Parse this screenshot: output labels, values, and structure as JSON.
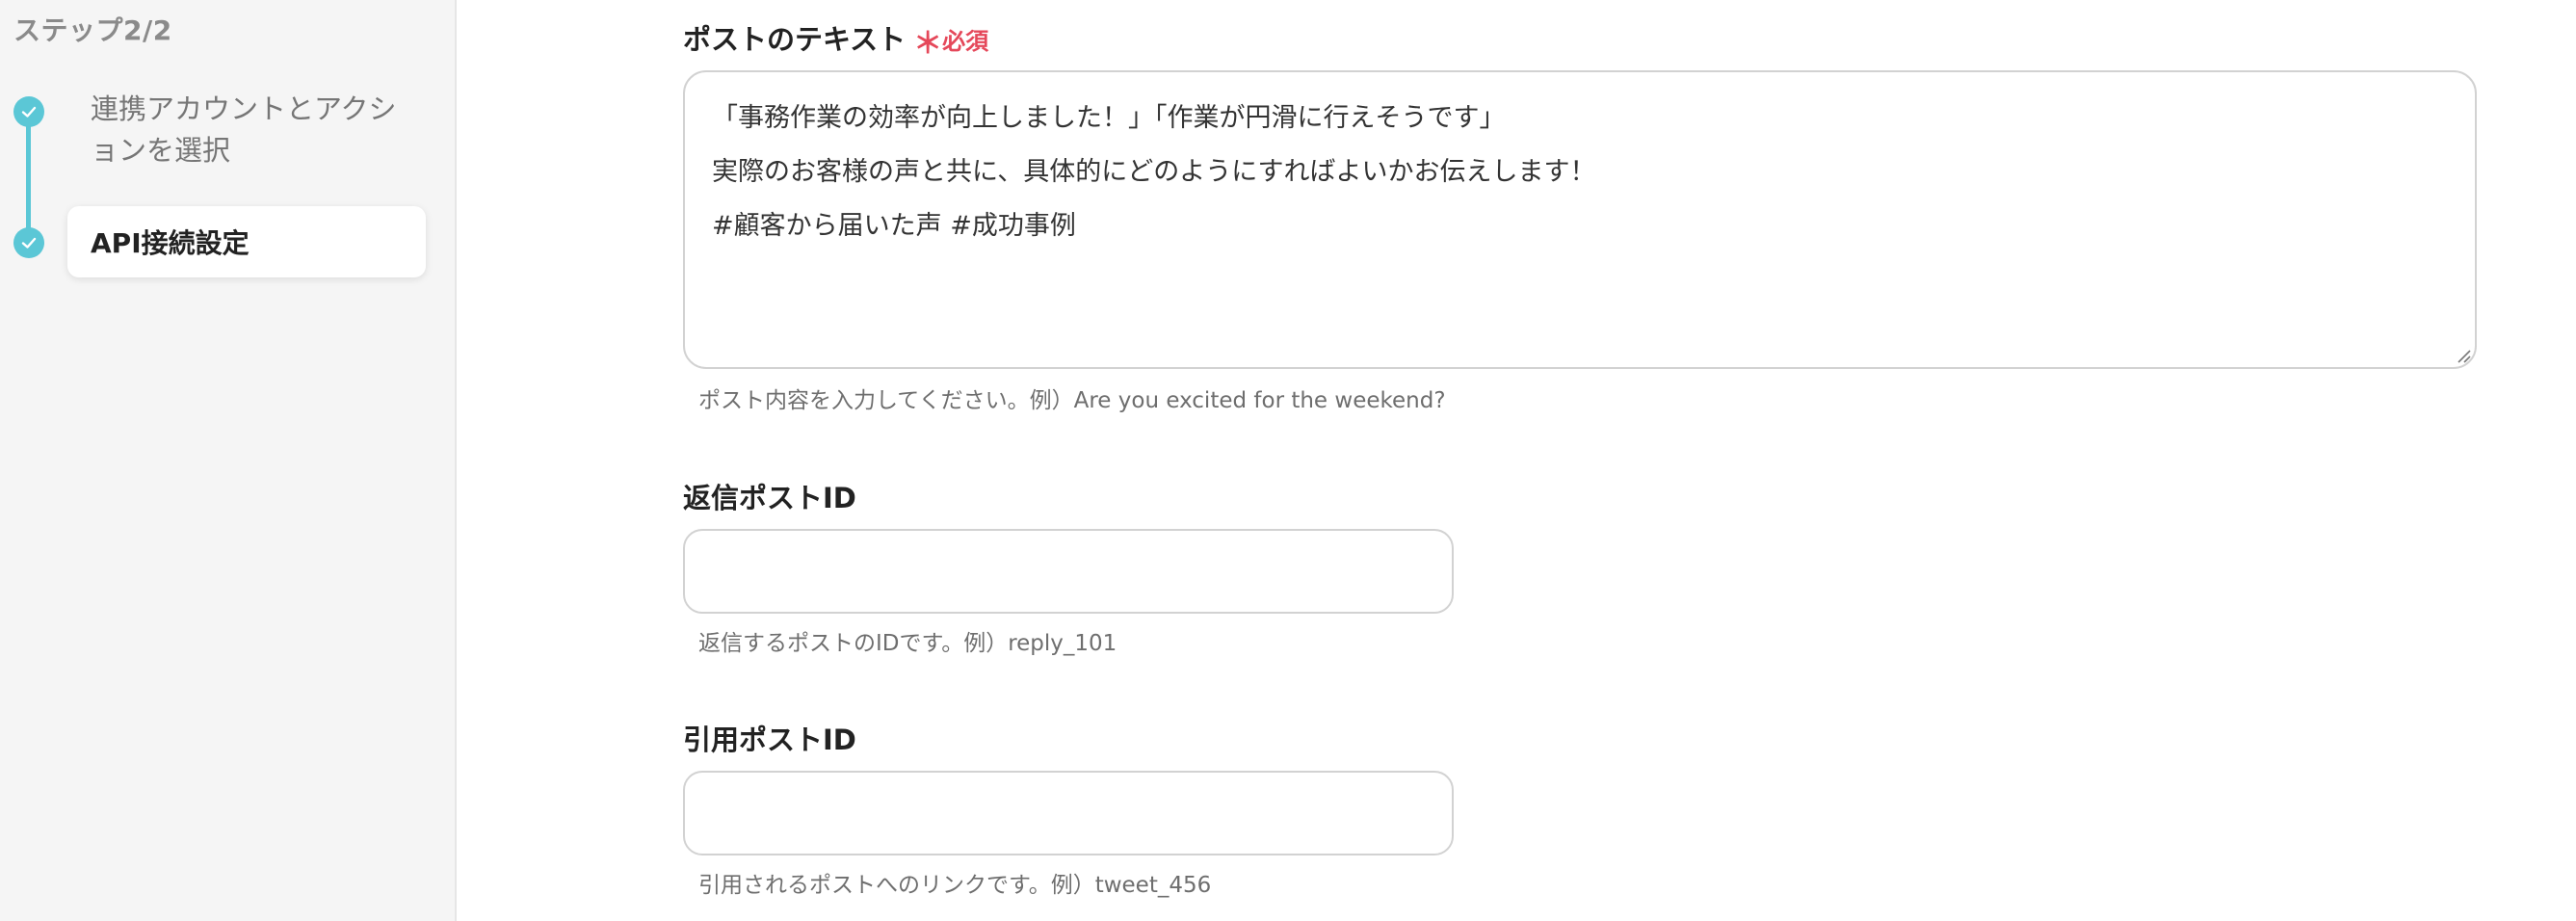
{
  "sidebar": {
    "step_count": "ステップ2/2",
    "steps": [
      {
        "label": "連携アカウントとアクションを選択",
        "status": "completed"
      },
      {
        "label": "API接続設定",
        "status": "current"
      }
    ],
    "accent_color": "#5bc7d6"
  },
  "form": {
    "post_text": {
      "label": "ポストのテキスト",
      "required_label": "必須",
      "required_mark": "＊",
      "lines": [
        "「事務作業の効率が向上しました！」「作業が円滑に行えそうです」",
        "実際のお客様の声と共に、具体的にどのようにすればよいかお伝えします！",
        "#顧客から届いた声 #成功事例"
      ],
      "hint": "ポスト内容を入力してください。例）Are you excited for the weekend?"
    },
    "reply_post_id": {
      "label": "返信ポストID",
      "value": "",
      "hint": "返信するポストのIDです。例）reply_101"
    },
    "quote_post_id": {
      "label": "引用ポストID",
      "value": "",
      "hint": "引用されるポストへのリンクです。例）tweet_456"
    },
    "required_color": "#e5485a"
  }
}
